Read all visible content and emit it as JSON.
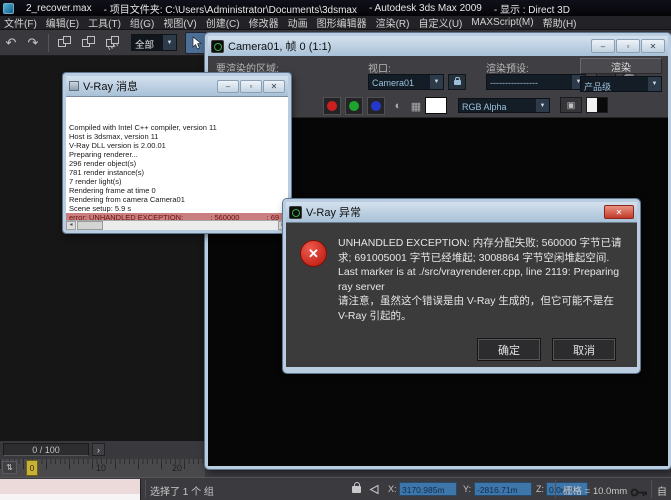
{
  "app": {
    "title_file": "2_recover.max",
    "title_project": "- 项目文件夹: C:\\Users\\Administrator\\Documents\\3dsmax",
    "title_app": "- Autodesk 3ds Max  2009",
    "title_display": "- 显示 : Direct 3D"
  },
  "menu": {
    "items": [
      "文件(F)",
      "编辑(E)",
      "工具(T)",
      "组(G)",
      "视图(V)",
      "创建(C)",
      "修改器",
      "动画",
      "图形编辑器",
      "渲染(R)",
      "自定义(U)",
      "MAXScript(M)",
      "帮助(H)"
    ]
  },
  "toolbar": {
    "filter_value": "全部"
  },
  "render_window": {
    "title": "Camera01, 帧 0 (1:1)",
    "area_label": "要渲染的区域:",
    "viewport_label": "视口:",
    "viewport_value": "Camera01",
    "preset_label": "渲染预设:",
    "preset_value": "----------------",
    "render_button": "渲染",
    "quality_value": "产品级",
    "channel_value": "RGB Alpha"
  },
  "message_window": {
    "title": "V-Ray 消息",
    "lines": [
      "Compiled with Intel C++ compiler, version 11",
      "Host is 3dsmax, version 11",
      "V-Ray DLL version is 2.00.01",
      "Preparing renderer...",
      "296 render object(s)",
      "781 render instance(s)",
      "7 render light(s)",
      "Rendering frame at time 0",
      "Rendering from camera Camera01",
      "Scene setup: 5.9 s"
    ],
    "error_line": "error: UNHANDLED EXCEPTION:             ; 560000             ; 69"
  },
  "dialog": {
    "title": "V-Ray 异常",
    "message_1": "UNHANDLED EXCEPTION: 内存分配失败; 560000 字节已请求; 691005001 字节已经堆起; 3008864 字节空闲堆起空间.",
    "message_2": "Last marker is at ./src/vrayrenderer.cpp, line 2119: Preparing ray server",
    "message_3": "请注意，虽然这个错误是由 V-Ray 生成的，但它可能不是在 V-Ray 引起的。",
    "ok_button": "确定",
    "cancel_button": "取消"
  },
  "timeline": {
    "frame_display": "0 / 100",
    "thumb_label": "0",
    "tick_labels": [
      "10",
      "20"
    ]
  },
  "status": {
    "selection_text": "选择了 1 个 组",
    "x_label": "X:",
    "x_value": "3170.985m",
    "y_label": "Y:",
    "y_value": "-2816.71m",
    "z_label": "Z:",
    "z_value": "0.0mm",
    "grid_text": "栅格 = 10.0mm",
    "autokey_text": "自"
  },
  "icons": {
    "undo": "↶",
    "redo": "↷",
    "dropdown_arrow": "▼",
    "minimize": "–",
    "maximize": "▫",
    "close": "✕",
    "mono": "◐",
    "alpha": "▦",
    "scroll_left": "◂",
    "scroll_right": "▸",
    "next_frame": "›",
    "timeline_toggle": "⇅",
    "error_x": "✕"
  },
  "colors": {
    "vray_green": "#38b14a",
    "error_red": "#c1352c",
    "field_blue": "#3f76aa",
    "aero_blue": "#b9cce0",
    "channel_red": "#cc2020",
    "channel_green": "#1fa32f",
    "channel_blue": "#2538cc"
  }
}
